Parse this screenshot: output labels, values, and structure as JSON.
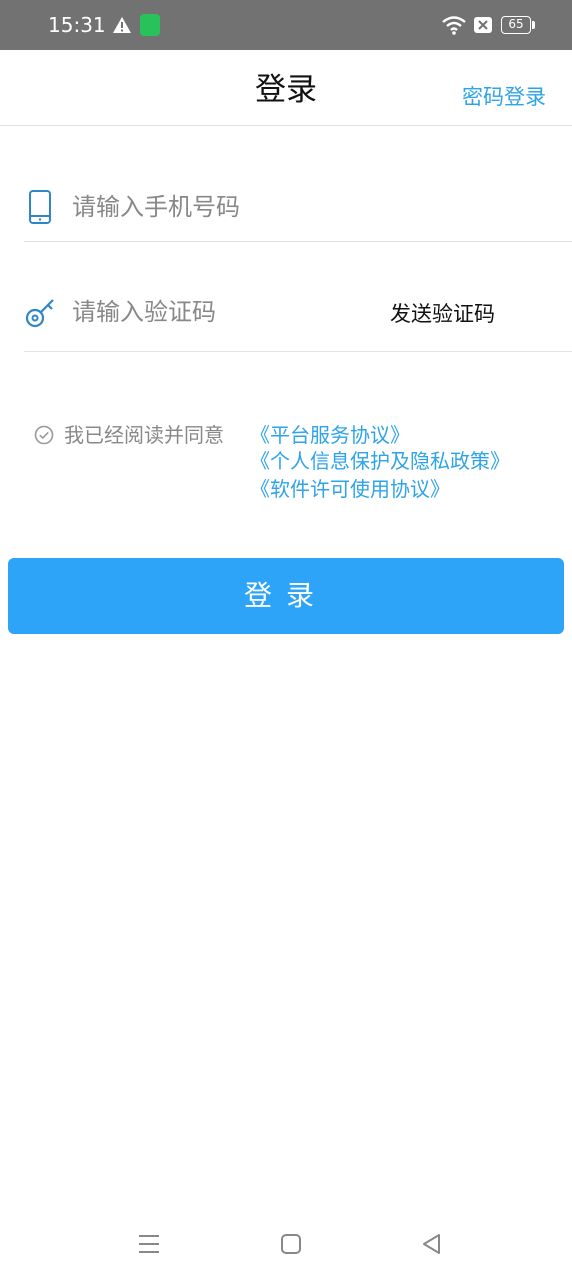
{
  "status_bar": {
    "time": "15:31",
    "battery": "65",
    "icons": [
      "warning-icon",
      "app-notification-icon",
      "wifi-icon",
      "no-sim-icon",
      "battery-icon"
    ]
  },
  "header": {
    "title": "登录",
    "password_login_label": "密码登录"
  },
  "form": {
    "phone_placeholder": "请输入手机号码",
    "phone_icon": "phone-icon",
    "code_placeholder": "请输入验证码",
    "code_icon": "key-icon",
    "send_code_label": "发送验证码"
  },
  "agreement": {
    "prefix": "我已经阅读并同意",
    "links": [
      "《平台服务协议》",
      "《个人信息保护及隐私政策》",
      "《软件许可使用协议》"
    ]
  },
  "login_button_label": "登录",
  "nav_bar": {
    "buttons": [
      "menu-icon",
      "home-icon",
      "back-icon"
    ]
  },
  "colors": {
    "accent": "#2ea4f8",
    "link": "#2ea4e8",
    "status_bar": "#727272",
    "divider": "#e2e2e2"
  }
}
